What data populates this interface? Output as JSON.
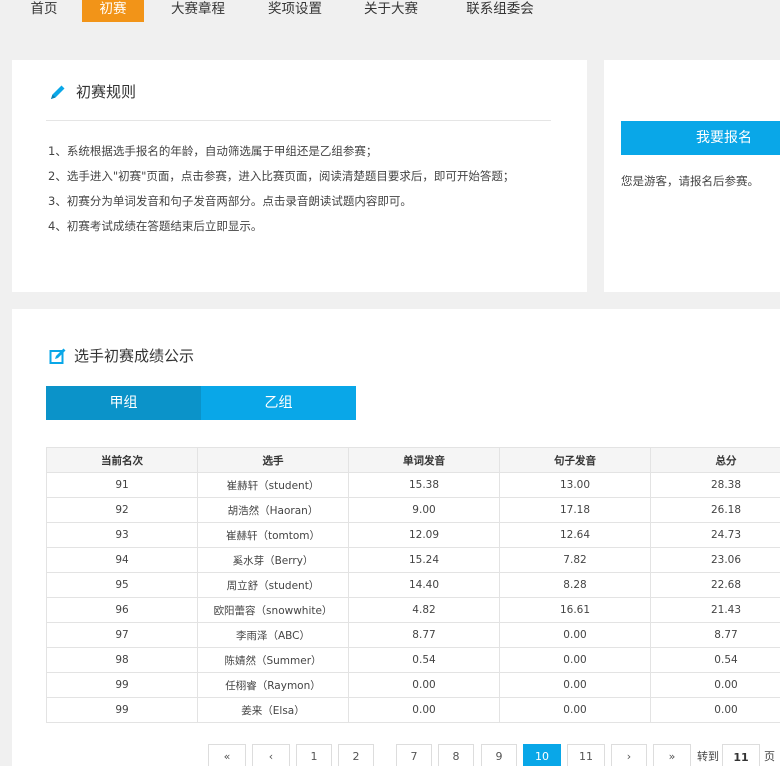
{
  "nav": {
    "items": [
      {
        "label": "首页"
      },
      {
        "label": "初赛",
        "active": true
      },
      {
        "label": "大赛章程"
      },
      {
        "label": "奖项设置"
      },
      {
        "label": "关于大赛"
      },
      {
        "label": "联系组委会"
      }
    ]
  },
  "rules": {
    "title": "初赛规则",
    "items": [
      "1、系统根据选手报名的年龄，自动筛选属于甲组还是乙组参赛；",
      "2、选手进入\"初赛\"页面，点击参赛，进入比赛页面，阅读清楚题目要求后，即可开始答题；",
      "3、初赛分为单词发音和句子发音两部分。点击录音朗读试题内容即可。",
      "4、初赛考试成绩在答题结束后立即显示。"
    ]
  },
  "signup": {
    "button_label": "我要报名",
    "guest_text": "您是游客，请报名后参赛。"
  },
  "scores": {
    "title": "选手初赛成绩公示",
    "tabs": [
      {
        "label": "甲组",
        "active": true
      },
      {
        "label": "乙组",
        "active": false
      }
    ],
    "columns": [
      "当前名次",
      "选手",
      "单词发音",
      "句子发音",
      "总分"
    ],
    "rows": [
      [
        "91",
        "崔赫轩（student）",
        "15.38",
        "13.00",
        "28.38"
      ],
      [
        "92",
        "胡浩然（Haoran）",
        "9.00",
        "17.18",
        "26.18"
      ],
      [
        "93",
        "崔赫轩（tomtom）",
        "12.09",
        "12.64",
        "24.73"
      ],
      [
        "94",
        "奚水芽（Berry）",
        "15.24",
        "7.82",
        "23.06"
      ],
      [
        "95",
        "周立舒（student）",
        "14.40",
        "8.28",
        "22.68"
      ],
      [
        "96",
        "欧阳蕾容（snowwhite）",
        "4.82",
        "16.61",
        "21.43"
      ],
      [
        "97",
        "李雨泽（ABC）",
        "8.77",
        "0.00",
        "8.77"
      ],
      [
        "98",
        "陈婧然（Summer）",
        "0.54",
        "0.00",
        "0.54"
      ],
      [
        "99",
        "任栩睿（Raymon）",
        "0.00",
        "0.00",
        "0.00"
      ],
      [
        "99",
        "姜来（Elsa）",
        "0.00",
        "0.00",
        "0.00"
      ]
    ]
  },
  "pager": {
    "first": "«",
    "prev": "‹",
    "pages": [
      "1",
      "2",
      "7",
      "8",
      "9",
      "10",
      "11"
    ],
    "current": "10",
    "next": "›",
    "last": "»",
    "goto_label": "转到",
    "goto_value": "11",
    "page_unit": "页"
  },
  "colors": {
    "accent_orange": "#f29418",
    "accent_blue": "#09a7e8",
    "tab_active_blue": "#0b93c9"
  }
}
